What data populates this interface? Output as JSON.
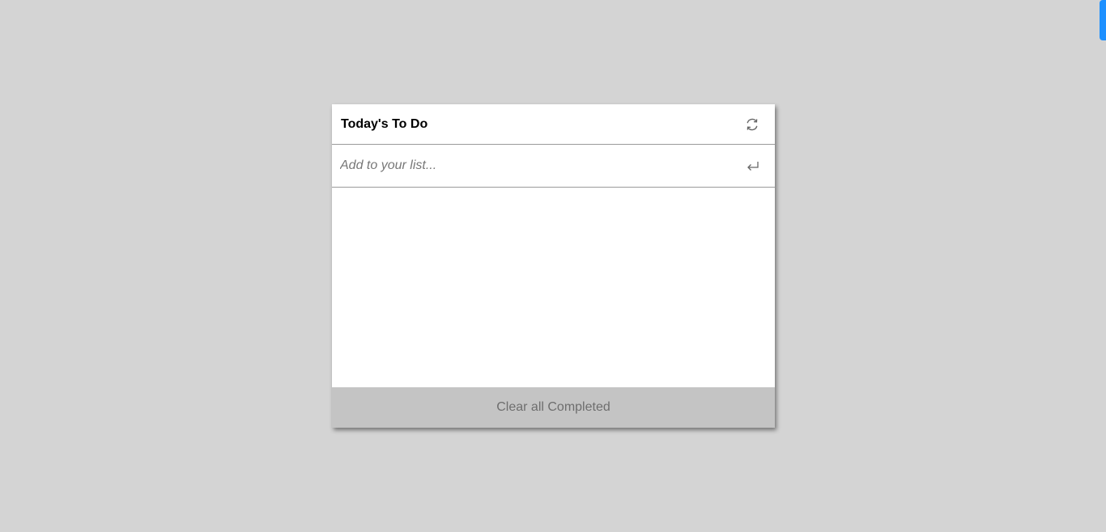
{
  "app": {
    "title": "Today's To Do"
  },
  "header": {
    "refresh_icon": "refresh-icon"
  },
  "input": {
    "placeholder": "Add to your list...",
    "value": "",
    "submit_icon": "enter-icon"
  },
  "list": {
    "items": []
  },
  "footer": {
    "clear_label": "Clear all Completed"
  },
  "colors": {
    "background": "#d4d4d4",
    "card": "#ffffff",
    "footer": "#c4c4c4",
    "accent_tab": "#1e90ff"
  }
}
